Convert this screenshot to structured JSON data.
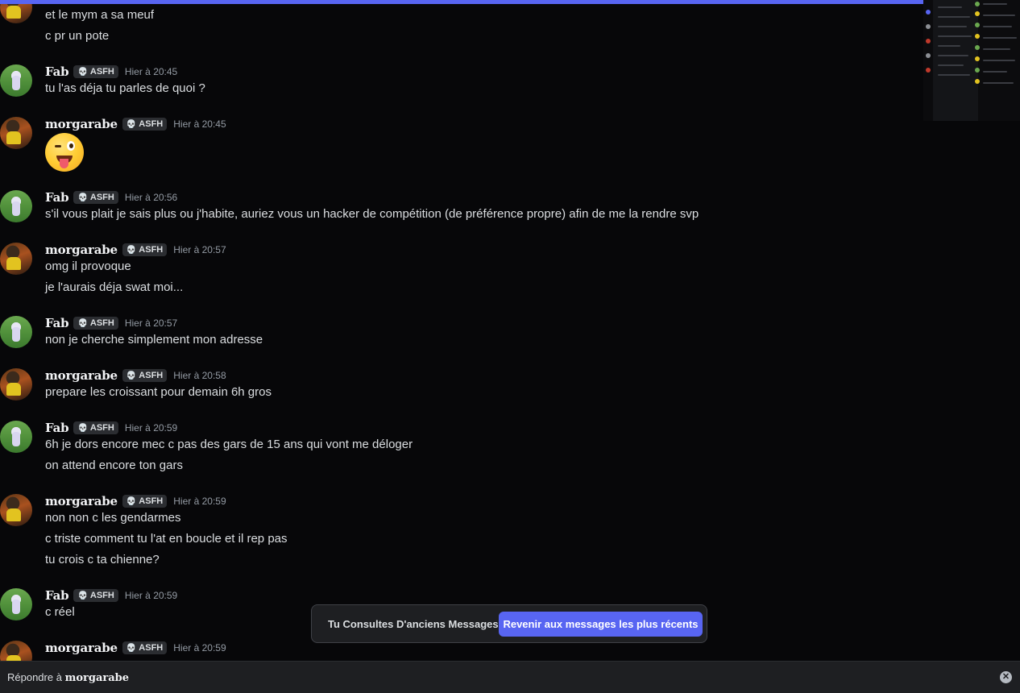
{
  "colors": {
    "accent": "#5865f2",
    "background": "#070709",
    "text": "#dbdee1",
    "muted": "#949ba4"
  },
  "messages": [
    {
      "lines": [
        "et le mym a sa meuf",
        "c pr un pote"
      ]
    },
    {
      "author": "Fab",
      "tag": "ASFH",
      "time": "Hier à 20:45",
      "lines": [
        "tu l'as déja tu parles de quoi ?"
      ]
    },
    {
      "author": "morgarabe",
      "tag": "ASFH",
      "time": "Hier à 20:45",
      "emoji": "winking-face-with-tongue"
    },
    {
      "author": "Fab",
      "tag": "ASFH",
      "time": "Hier à 20:56",
      "lines": [
        "s'il vous plait je sais plus ou j'habite, auriez vous un hacker de compétition (de préférence propre) afin de me la rendre svp"
      ]
    },
    {
      "author": "morgarabe",
      "tag": "ASFH",
      "time": "Hier à 20:57",
      "lines": [
        "omg il provoque",
        "je l'aurais déja swat moi..."
      ]
    },
    {
      "author": "Fab",
      "tag": "ASFH",
      "time": "Hier à 20:57",
      "lines": [
        "non je cherche simplement mon adresse"
      ]
    },
    {
      "author": "morgarabe",
      "tag": "ASFH",
      "time": "Hier à 20:58",
      "lines": [
        "prepare les croissant pour demain 6h gros"
      ]
    },
    {
      "author": "Fab",
      "tag": "ASFH",
      "time": "Hier à 20:59",
      "lines": [
        "6h je dors encore mec c pas des gars de 15 ans qui vont me déloger",
        "on attend encore ton gars"
      ]
    },
    {
      "author": "morgarabe",
      "tag": "ASFH",
      "time": "Hier à 20:59",
      "lines": [
        "non non c les gendarmes",
        "c triste comment tu l'at en boucle et il rep pas",
        "tu crois c ta chienne?"
      ]
    },
    {
      "author": "Fab",
      "tag": "ASFH",
      "time": "Hier à 20:59",
      "lines": [
        "c réel"
      ]
    },
    {
      "author": "morgarabe",
      "tag": "ASFH",
      "time": "Hier à 20:59",
      "lines": []
    }
  ],
  "banner": {
    "text": "Tu Consultes D'anciens Messages",
    "button": "Revenir aux messages les plus récents"
  },
  "reply": {
    "prefix": "Répondre à",
    "name": "morgarabe"
  }
}
